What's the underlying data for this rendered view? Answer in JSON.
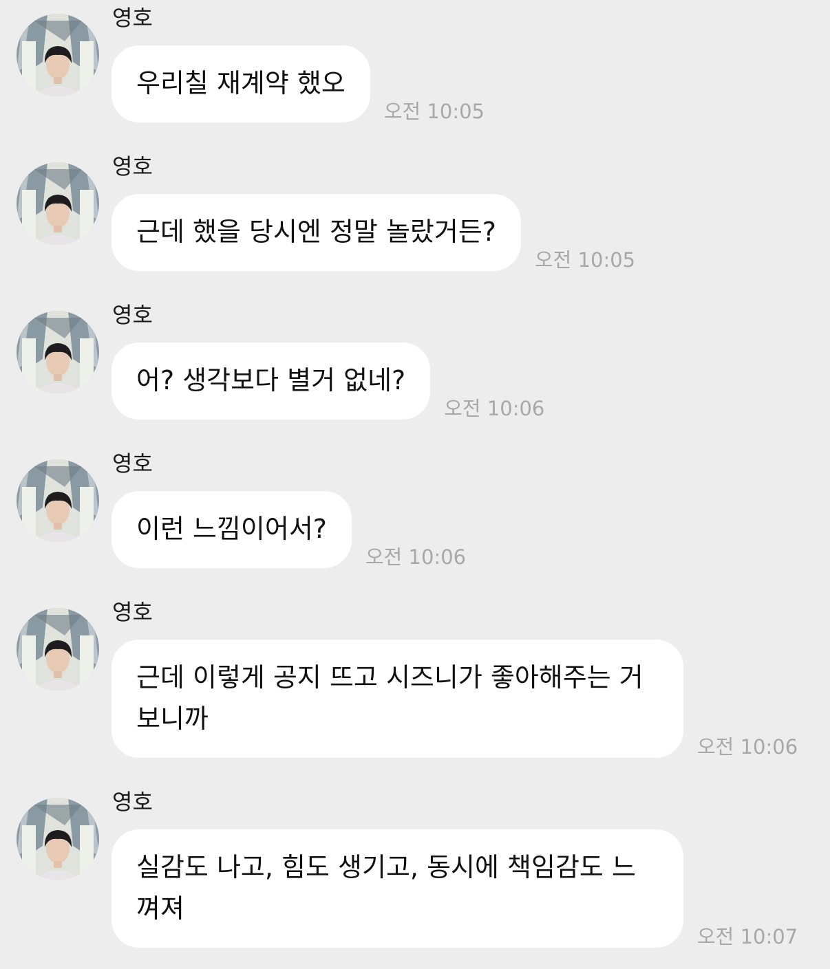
{
  "contact": {
    "name": "영호",
    "avatar_icon": "profile-photo"
  },
  "messages": [
    {
      "sender": "영호",
      "text": "우리칠 재계약 했오",
      "time": "오전 10:05"
    },
    {
      "sender": "영호",
      "text": "근데 했을 당시엔 정말 놀랐거든?",
      "time": "오전 10:05"
    },
    {
      "sender": "영호",
      "text": "어? 생각보다 별거 없네?",
      "time": "오전 10:06"
    },
    {
      "sender": "영호",
      "text": "이런 느낌이어서?",
      "time": "오전 10:06"
    },
    {
      "sender": "영호",
      "text": "근데 이렇게 공지 뜨고 시즈니가 좋아해주는 거 보니까",
      "time": "오전 10:06"
    },
    {
      "sender": "영호",
      "text": "실감도 나고, 힘도 생기고, 동시에 책임감도 느껴져",
      "time": "오전 10:07"
    }
  ],
  "colors": {
    "background": "#ededed",
    "bubble": "#ffffff",
    "text": "#111111",
    "timestamp": "#a8a8a8"
  }
}
